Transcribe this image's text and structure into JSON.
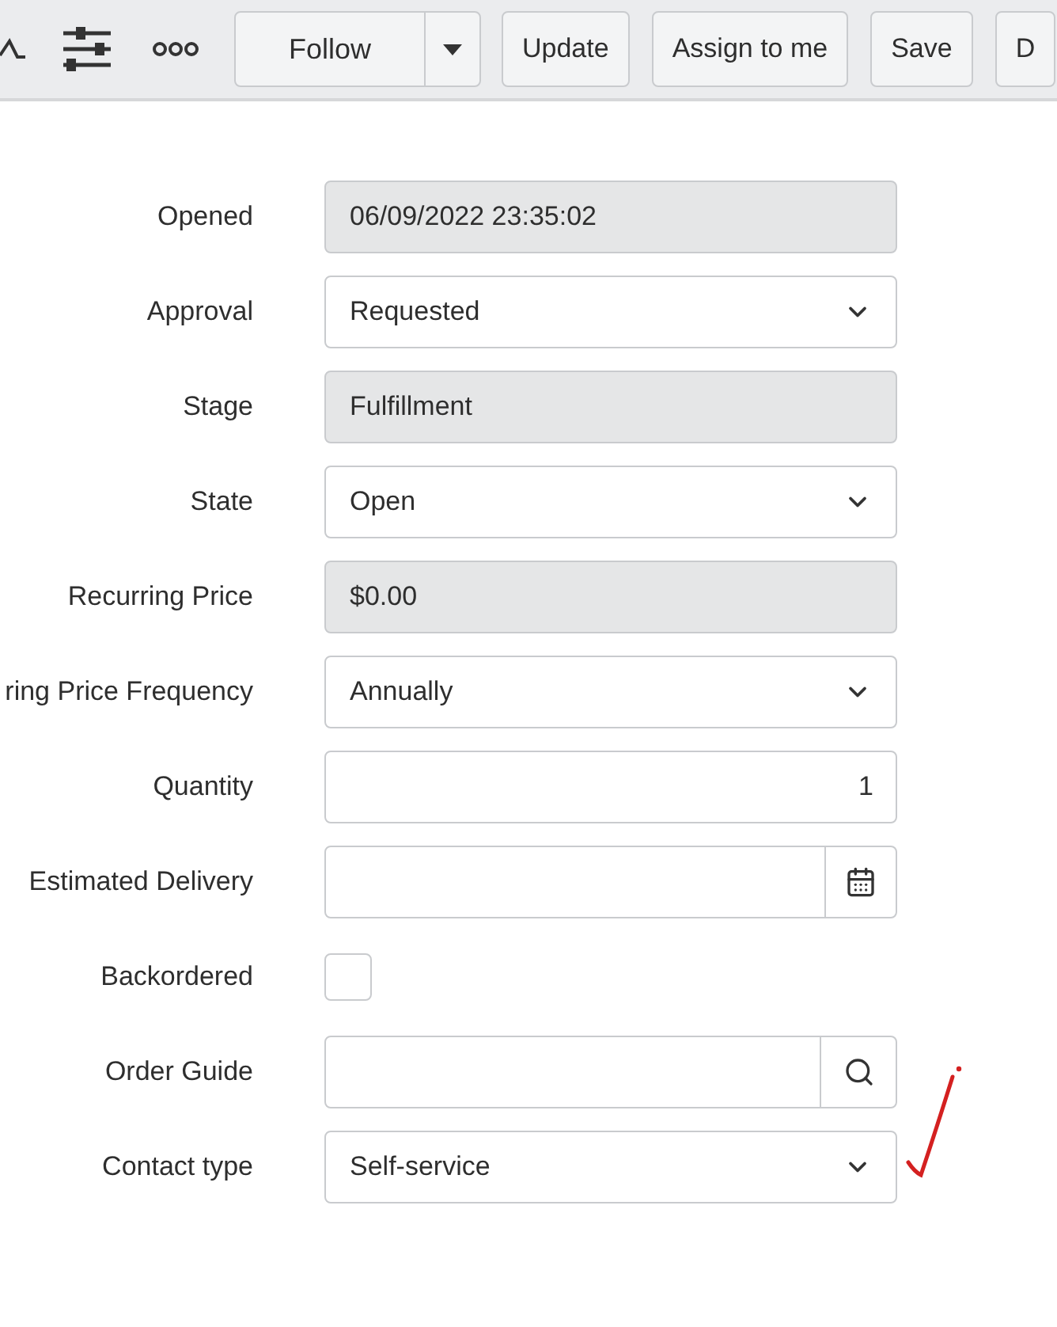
{
  "toolbar": {
    "follow_button": "Follow",
    "buttons": [
      "Update",
      "Assign to me",
      "Save",
      "D"
    ]
  },
  "fields": [
    {
      "label": "Opened",
      "kind": "readonly",
      "value": "06/09/2022 23:35:02"
    },
    {
      "label": "Approval",
      "kind": "select",
      "value": "Requested"
    },
    {
      "label": "Stage",
      "kind": "readonly",
      "value": "Fulfillment"
    },
    {
      "label": "State",
      "kind": "select",
      "value": "Open"
    },
    {
      "label": "Recurring Price",
      "kind": "readonly",
      "value": "$0.00"
    },
    {
      "label": "ring Price Frequency",
      "kind": "select",
      "value": "Annually"
    },
    {
      "label": "Quantity",
      "kind": "number",
      "value": "1"
    },
    {
      "label": "Estimated Delivery",
      "kind": "date"
    },
    {
      "label": "Backordered",
      "kind": "checkbox",
      "checked": false
    },
    {
      "label": "Order Guide",
      "kind": "reference"
    },
    {
      "label": "Contact type",
      "kind": "select",
      "value": "Self-service"
    }
  ]
}
